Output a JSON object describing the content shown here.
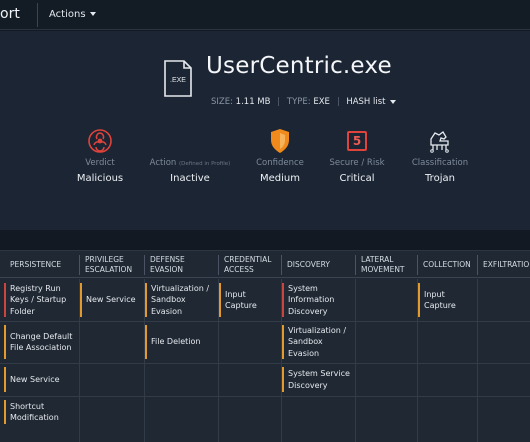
{
  "topbar": {
    "brand": "ort",
    "actions_label": "Actions"
  },
  "file": {
    "icon_label": ".EXE",
    "name": "UserCentric.exe",
    "size_label": "SIZE:",
    "size": "1.11 MB",
    "type_label": "TYPE:",
    "type": "EXE",
    "hash_label": "HASH list"
  },
  "stats": [
    {
      "label": "Verdict",
      "value": "Malicious",
      "icon": "biohazard-icon",
      "color": "#e0433b"
    },
    {
      "label": "Action",
      "sublabel": "(Defined in Profile)",
      "value": "Inactive",
      "icon": "none"
    },
    {
      "label": "Confidence",
      "value": "Medium",
      "icon": "shield-icon",
      "color": "#f08a1c"
    },
    {
      "label": "Secure / Risk",
      "value": "Critical",
      "icon": "risk-box-icon",
      "number": "5",
      "color": "#e0433b"
    },
    {
      "label": "Classification",
      "value": "Trojan",
      "icon": "trojan-horse-icon"
    }
  ],
  "matrix": {
    "columns": [
      {
        "label": "PERSISTENCE"
      },
      {
        "label": "PRIVILEGE ESCALATION"
      },
      {
        "label": "DEFENSE EVASION"
      },
      {
        "label": "CREDENTIAL ACCESS"
      },
      {
        "label": "DISCOVERY"
      },
      {
        "label": "LATERAL MOVEMENT"
      },
      {
        "label": "COLLECTION"
      },
      {
        "label": "EXFILTRATIO"
      }
    ],
    "cells": {
      "persistence": [
        "Registry Run Keys / Startup Folder",
        "Change Default File Association",
        "New Service",
        "Shortcut Modification"
      ],
      "privilege_escalation": [
        "New Service"
      ],
      "defense_evasion": [
        "Virtualization / Sandbox Evasion",
        "File Deletion"
      ],
      "credential_access": [
        "Input Capture"
      ],
      "discovery": [
        "System Information Discovery",
        "Virtualization / Sandbox Evasion",
        "System Service Discovery"
      ],
      "collection": [
        "Input Capture"
      ]
    }
  }
}
